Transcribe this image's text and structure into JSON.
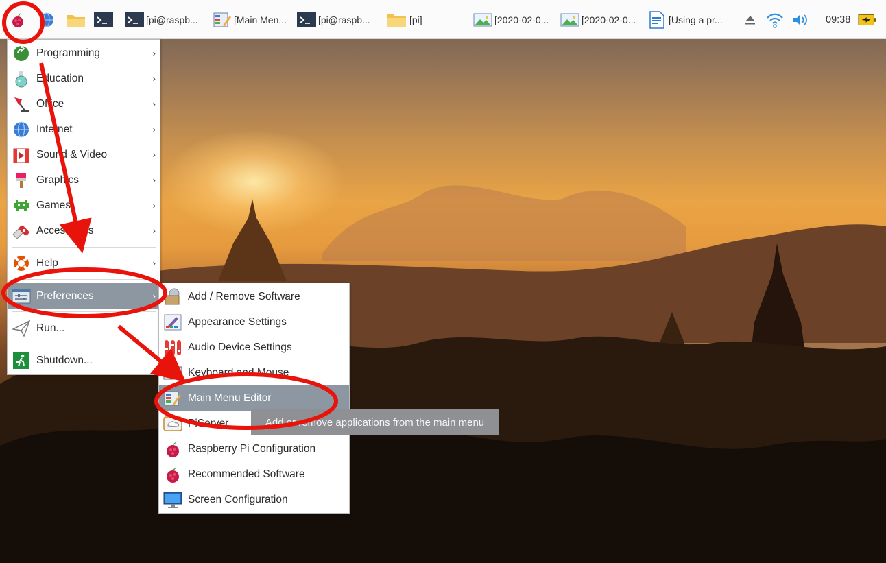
{
  "taskbar": {
    "tasks": [
      {
        "label": "[pi@raspb...",
        "icon": "terminal-icon"
      },
      {
        "label": "[Main Men...",
        "icon": "menu-editor-icon"
      },
      {
        "label": "[pi@raspb...",
        "icon": "terminal-icon"
      },
      {
        "label": "[pi]",
        "icon": "folder-icon"
      },
      {
        "label": "[2020-02-0...",
        "icon": "image-viewer-icon"
      },
      {
        "label": "[2020-02-0...",
        "icon": "image-viewer-icon"
      },
      {
        "label": "[Using a pr...",
        "icon": "document-icon"
      }
    ],
    "clock": "09:38"
  },
  "main_menu": {
    "items": [
      {
        "label": "Programming",
        "icon": "programming-icon",
        "arrow": "›"
      },
      {
        "label": "Education",
        "icon": "education-flask-icon",
        "arrow": "›"
      },
      {
        "label": "Office",
        "icon": "office-lamp-icon",
        "arrow": "›"
      },
      {
        "label": "Internet",
        "icon": "globe-icon",
        "arrow": "›"
      },
      {
        "label": "Sound & Video",
        "icon": "sound-video-icon",
        "arrow": "›"
      },
      {
        "label": "Graphics",
        "icon": "graphics-brush-icon",
        "arrow": "›"
      },
      {
        "label": "Games",
        "icon": "games-invader-icon",
        "arrow": "›"
      },
      {
        "label": "Accessories",
        "icon": "accessories-knife-icon",
        "arrow": "›"
      },
      {
        "label": "Help",
        "icon": "help-lifebuoy-icon",
        "arrow": "›"
      },
      {
        "label": "Preferences",
        "icon": "preferences-icon",
        "arrow": "›"
      },
      {
        "label": "Run...",
        "icon": "run-paperplane-icon"
      },
      {
        "label": "Shutdown...",
        "icon": "shutdown-exit-icon"
      }
    ]
  },
  "prefs_menu": {
    "items": [
      {
        "label": "Add / Remove Software",
        "icon": "package-icon"
      },
      {
        "label": "Appearance Settings",
        "icon": "appearance-icon"
      },
      {
        "label": "Audio Device Settings",
        "icon": "audio-mixer-icon"
      },
      {
        "label": "Keyboard and Mouse",
        "icon": "keyboard-icon"
      },
      {
        "label": "Main Menu Editor",
        "icon": "menu-editor-icon"
      },
      {
        "label": "PiServer",
        "icon": "piserver-icon"
      },
      {
        "label": "Raspberry Pi Configuration",
        "icon": "raspberry-icon"
      },
      {
        "label": "Recommended Software",
        "icon": "raspberry-icon"
      },
      {
        "label": "Screen Configuration",
        "icon": "monitor-icon"
      }
    ]
  },
  "tooltip": {
    "text": "Add or remove applications from the main menu"
  },
  "colors": {
    "highlight": "#8d97a1",
    "annotation": "#e8140c",
    "tooltip": "#8e9093"
  }
}
